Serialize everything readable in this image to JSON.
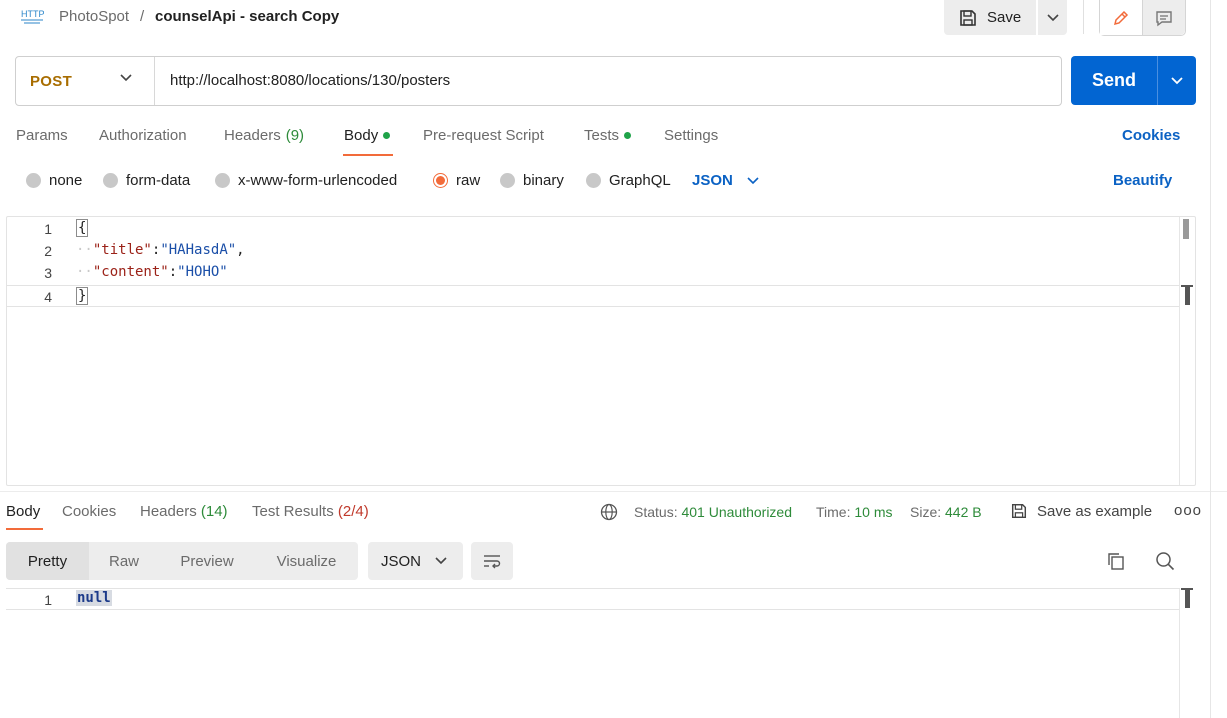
{
  "header": {
    "breadcrumb_parent": "PhotoSpot",
    "breadcrumb_sep": "/",
    "title": "counselApi - search Copy",
    "save_label": "Save",
    "icons": [
      "http-icon",
      "save-disk-icon",
      "chevron-down-icon",
      "pencil-icon",
      "comment-icon"
    ]
  },
  "request": {
    "method": "POST",
    "url": "http://localhost:8080/locations/130/posters",
    "send_label": "Send"
  },
  "request_tabs": {
    "params": "Params",
    "authorization": "Authorization",
    "headers": "Headers",
    "headers_count": "(9)",
    "body": "Body",
    "prerequest": "Pre-request Script",
    "tests": "Tests",
    "settings": "Settings",
    "cookies": "Cookies",
    "active": "Body"
  },
  "body_types": {
    "none": "none",
    "form_data": "form-data",
    "urlencoded": "x-www-form-urlencoded",
    "raw": "raw",
    "binary": "binary",
    "graphql": "GraphQL",
    "selected": "raw",
    "language": "JSON",
    "beautify": "Beautify"
  },
  "editor": {
    "lines": [
      {
        "n": "1",
        "text": "{"
      },
      {
        "n": "2",
        "key": "\"title\"",
        "value": "\"HAHasdA\""
      },
      {
        "n": "3",
        "key": "\"content\"",
        "value": "\"HOHO\""
      },
      {
        "n": "4",
        "text": "}"
      }
    ]
  },
  "response": {
    "tabs": {
      "body": "Body",
      "cookies": "Cookies",
      "headers": "Headers",
      "headers_count": "(14)",
      "test_results": "Test Results",
      "test_count": "(2/4)"
    },
    "status_label": "Status:",
    "status_value": "401 Unauthorized",
    "time_label": "Time:",
    "time_value": "10 ms",
    "size_label": "Size:",
    "size_value": "442 B",
    "save_example": "Save as example",
    "more": "ooo",
    "views": [
      "Pretty",
      "Raw",
      "Preview",
      "Visualize"
    ],
    "active_view": "Pretty",
    "format": "JSON",
    "line_number": "1",
    "content": "null"
  },
  "colors": {
    "accent_orange": "#f26b3a",
    "send_blue": "#0265d2",
    "link_blue": "#0b62c4",
    "method_post": "#a86d00",
    "status_green": "#2e8b3a",
    "fail_red": "#c0392b"
  }
}
